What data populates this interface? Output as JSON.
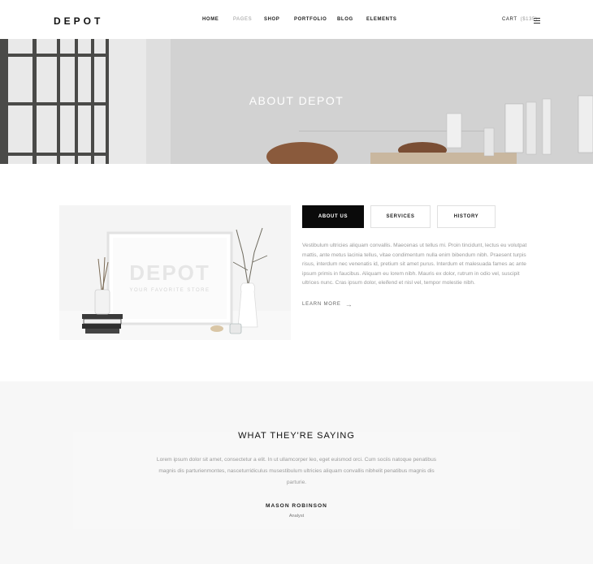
{
  "header": {
    "logo": "DEPOT",
    "nav": [
      "HOME",
      "PAGES",
      "SHOP",
      "PORTFOLIO",
      "BLOG",
      "ELEMENTS"
    ],
    "cart_label": "CART",
    "cart_count": "($135)"
  },
  "hero": {
    "title": "ABOUT DEPOT"
  },
  "about": {
    "image": {
      "brand": "DEPOT",
      "tagline": "YOUR FAVORITE STORE"
    },
    "tabs": [
      "ABOUT US",
      "SERVICES",
      "HISTORY"
    ],
    "active_tab": "ABOUT US",
    "text": "Vestibulum ultricies aliquam convallis. Maecenas ut tellus mi. Proin tincidunt, lectus eu volutpat mattis, ante metus lacinia tellus, vitae condimentum nulla enim bibendum nibh. Praesent turpis risus, interdum nec venenatis id, pretium sit amet purus. Interdum et malesuada fames ac ante ipsum primis in faucibus. Aliquam eu lorem nibh. Mauris ex dolor, rutrum in odio vel, suscipit ultrices nunc. Cras ipsum dolor, eleifend et nisl vel, tempor molestie nibh.",
    "learn_more": "LEARN MORE"
  },
  "testimonials": {
    "title": "WHAT THEY'RE SAYING",
    "quote": "Lorem ipsum dolor sit amet, consectetur a elit. In ut ullamcorper leo, eget euismod orci. Cum sociis natoque penatibus magnis dis parturienmontes, nasceturridiculus musestibulum ultricies aliquam convallis nibhelit penatibus magnis dis parturie.",
    "name": "MASON ROBINSON",
    "role": "Analyst"
  },
  "colors": {
    "accent": "#0a0a0a",
    "muted_text": "#9a9a9a",
    "section_bg": "#f7f7f7"
  }
}
